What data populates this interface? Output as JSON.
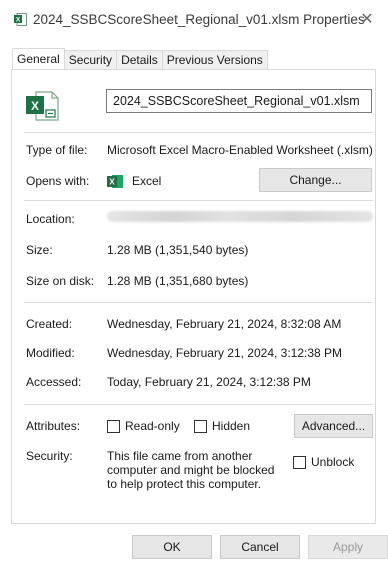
{
  "window": {
    "title": "2024_SSBCScoreSheet_Regional_v01.xlsm Properties",
    "close_glyph": "✕"
  },
  "tabs": [
    "General",
    "Security",
    "Details",
    "Previous Versions"
  ],
  "active_tab": "General",
  "general": {
    "file_name": "2024_SSBCScoreSheet_Regional_v01.xlsm",
    "type_label": "Type of file:",
    "type_value": "Microsoft Excel Macro-Enabled Worksheet (.xlsm)",
    "opens_label": "Opens with:",
    "opens_value": "Excel",
    "change_button": "Change...",
    "location_label": "Location:",
    "size_label": "Size:",
    "size_value": "1.28 MB (1,351,540 bytes)",
    "size_on_disk_label": "Size on disk:",
    "size_on_disk_value": "1.28 MB (1,351,680 bytes)",
    "created_label": "Created:",
    "created_value": "Wednesday, February 21, 2024, 8:32:08 AM",
    "modified_label": "Modified:",
    "modified_value": "Wednesday, February 21, 2024, 3:12:38 PM",
    "accessed_label": "Accessed:",
    "accessed_value": "Today, February 21, 2024, 3:12:38 PM",
    "attributes_label": "Attributes:",
    "readonly_label": "Read-only",
    "readonly_checked": false,
    "hidden_label": "Hidden",
    "hidden_checked": false,
    "advanced_button": "Advanced...",
    "security_label": "Security:",
    "security_text": "This file came from another computer and might be blocked to help protect this computer.",
    "unblock_label": "Unblock",
    "unblock_checked": false
  },
  "footer": {
    "ok": "OK",
    "cancel": "Cancel",
    "apply": "Apply"
  },
  "colors": {
    "excel_green": "#1e7145",
    "accent": "#0067c0"
  },
  "icons": {
    "title": "excel-file-icon",
    "file": "excel-file-icon",
    "opens_with": "excel-app-icon",
    "close": "close-icon"
  }
}
